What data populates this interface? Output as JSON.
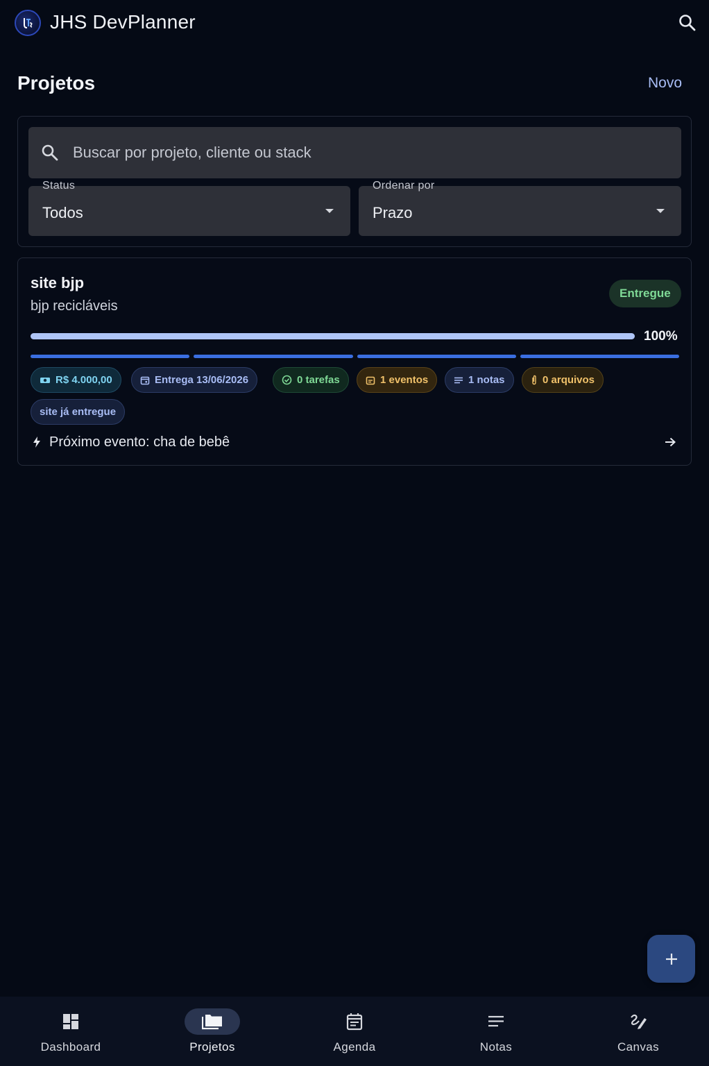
{
  "app": {
    "title": "JHS DevPlanner"
  },
  "header": {
    "title": "Projetos",
    "new_label": "Novo"
  },
  "filters": {
    "search_placeholder": "Buscar por projeto, cliente ou stack",
    "status": {
      "label": "Status",
      "value": "Todos"
    },
    "sort": {
      "label": "Ordenar por",
      "value": "Prazo"
    }
  },
  "projects": [
    {
      "name": "site bjp",
      "client": "bjp recicláveis",
      "status": "Entregue",
      "progress": 100,
      "progress_label": "100%",
      "stages_completed": 4,
      "stages_total": 4,
      "chips": {
        "value": "R$ 4.000,00",
        "delivery": "Entrega 13/06/2026",
        "tasks": "0 tarefas",
        "events": "1 eventos",
        "notes": "1 notas",
        "files": "0 arquivos"
      },
      "tags": [
        "site já entregue"
      ],
      "next_event": "Próximo evento: cha de bebê"
    }
  ],
  "bottom_nav": {
    "items": [
      {
        "label": "Dashboard",
        "icon": "dashboard-icon"
      },
      {
        "label": "Projetos",
        "icon": "folder-icon",
        "active": true
      },
      {
        "label": "Agenda",
        "icon": "calendar-icon"
      },
      {
        "label": "Notas",
        "icon": "notes-icon"
      },
      {
        "label": "Canvas",
        "icon": "draw-icon"
      }
    ]
  },
  "colors": {
    "background": "#050a15",
    "accent": "#a9bdf5",
    "progress": "#aec4f6",
    "success": "#7fd996",
    "warning": "#f0c16a",
    "fab": "#2b4880"
  }
}
